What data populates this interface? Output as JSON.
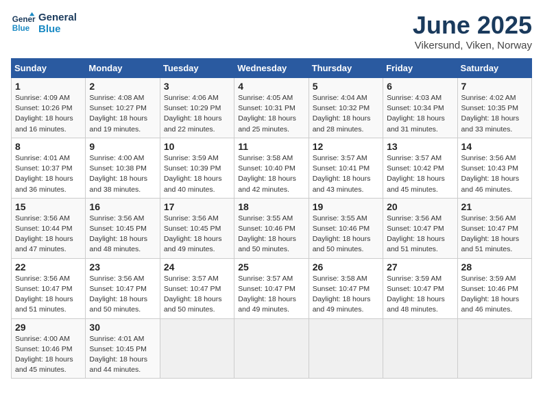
{
  "logo": {
    "line1": "General",
    "line2": "Blue"
  },
  "title": "June 2025",
  "subtitle": "Vikersund, Viken, Norway",
  "days_of_week": [
    "Sunday",
    "Monday",
    "Tuesday",
    "Wednesday",
    "Thursday",
    "Friday",
    "Saturday"
  ],
  "weeks": [
    [
      {
        "day": "1",
        "detail": "Sunrise: 4:09 AM\nSunset: 10:26 PM\nDaylight: 18 hours\nand 16 minutes."
      },
      {
        "day": "2",
        "detail": "Sunrise: 4:08 AM\nSunset: 10:27 PM\nDaylight: 18 hours\nand 19 minutes."
      },
      {
        "day": "3",
        "detail": "Sunrise: 4:06 AM\nSunset: 10:29 PM\nDaylight: 18 hours\nand 22 minutes."
      },
      {
        "day": "4",
        "detail": "Sunrise: 4:05 AM\nSunset: 10:31 PM\nDaylight: 18 hours\nand 25 minutes."
      },
      {
        "day": "5",
        "detail": "Sunrise: 4:04 AM\nSunset: 10:32 PM\nDaylight: 18 hours\nand 28 minutes."
      },
      {
        "day": "6",
        "detail": "Sunrise: 4:03 AM\nSunset: 10:34 PM\nDaylight: 18 hours\nand 31 minutes."
      },
      {
        "day": "7",
        "detail": "Sunrise: 4:02 AM\nSunset: 10:35 PM\nDaylight: 18 hours\nand 33 minutes."
      }
    ],
    [
      {
        "day": "8",
        "detail": "Sunrise: 4:01 AM\nSunset: 10:37 PM\nDaylight: 18 hours\nand 36 minutes."
      },
      {
        "day": "9",
        "detail": "Sunrise: 4:00 AM\nSunset: 10:38 PM\nDaylight: 18 hours\nand 38 minutes."
      },
      {
        "day": "10",
        "detail": "Sunrise: 3:59 AM\nSunset: 10:39 PM\nDaylight: 18 hours\nand 40 minutes."
      },
      {
        "day": "11",
        "detail": "Sunrise: 3:58 AM\nSunset: 10:40 PM\nDaylight: 18 hours\nand 42 minutes."
      },
      {
        "day": "12",
        "detail": "Sunrise: 3:57 AM\nSunset: 10:41 PM\nDaylight: 18 hours\nand 43 minutes."
      },
      {
        "day": "13",
        "detail": "Sunrise: 3:57 AM\nSunset: 10:42 PM\nDaylight: 18 hours\nand 45 minutes."
      },
      {
        "day": "14",
        "detail": "Sunrise: 3:56 AM\nSunset: 10:43 PM\nDaylight: 18 hours\nand 46 minutes."
      }
    ],
    [
      {
        "day": "15",
        "detail": "Sunrise: 3:56 AM\nSunset: 10:44 PM\nDaylight: 18 hours\nand 47 minutes."
      },
      {
        "day": "16",
        "detail": "Sunrise: 3:56 AM\nSunset: 10:45 PM\nDaylight: 18 hours\nand 48 minutes."
      },
      {
        "day": "17",
        "detail": "Sunrise: 3:56 AM\nSunset: 10:45 PM\nDaylight: 18 hours\nand 49 minutes."
      },
      {
        "day": "18",
        "detail": "Sunrise: 3:55 AM\nSunset: 10:46 PM\nDaylight: 18 hours\nand 50 minutes."
      },
      {
        "day": "19",
        "detail": "Sunrise: 3:55 AM\nSunset: 10:46 PM\nDaylight: 18 hours\nand 50 minutes."
      },
      {
        "day": "20",
        "detail": "Sunrise: 3:56 AM\nSunset: 10:47 PM\nDaylight: 18 hours\nand 51 minutes."
      },
      {
        "day": "21",
        "detail": "Sunrise: 3:56 AM\nSunset: 10:47 PM\nDaylight: 18 hours\nand 51 minutes."
      }
    ],
    [
      {
        "day": "22",
        "detail": "Sunrise: 3:56 AM\nSunset: 10:47 PM\nDaylight: 18 hours\nand 51 minutes."
      },
      {
        "day": "23",
        "detail": "Sunrise: 3:56 AM\nSunset: 10:47 PM\nDaylight: 18 hours\nand 50 minutes."
      },
      {
        "day": "24",
        "detail": "Sunrise: 3:57 AM\nSunset: 10:47 PM\nDaylight: 18 hours\nand 50 minutes."
      },
      {
        "day": "25",
        "detail": "Sunrise: 3:57 AM\nSunset: 10:47 PM\nDaylight: 18 hours\nand 49 minutes."
      },
      {
        "day": "26",
        "detail": "Sunrise: 3:58 AM\nSunset: 10:47 PM\nDaylight: 18 hours\nand 49 minutes."
      },
      {
        "day": "27",
        "detail": "Sunrise: 3:59 AM\nSunset: 10:47 PM\nDaylight: 18 hours\nand 48 minutes."
      },
      {
        "day": "28",
        "detail": "Sunrise: 3:59 AM\nSunset: 10:46 PM\nDaylight: 18 hours\nand 46 minutes."
      }
    ],
    [
      {
        "day": "29",
        "detail": "Sunrise: 4:00 AM\nSunset: 10:46 PM\nDaylight: 18 hours\nand 45 minutes."
      },
      {
        "day": "30",
        "detail": "Sunrise: 4:01 AM\nSunset: 10:45 PM\nDaylight: 18 hours\nand 44 minutes."
      },
      {
        "day": "",
        "detail": ""
      },
      {
        "day": "",
        "detail": ""
      },
      {
        "day": "",
        "detail": ""
      },
      {
        "day": "",
        "detail": ""
      },
      {
        "day": "",
        "detail": ""
      }
    ]
  ]
}
